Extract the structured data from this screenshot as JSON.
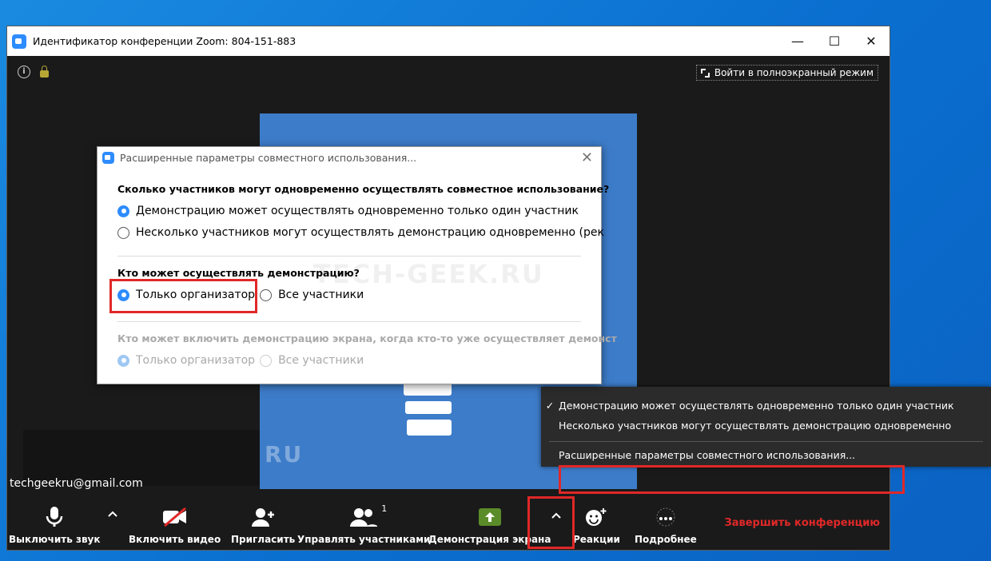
{
  "window": {
    "title": "Идентификатор конференции Zoom: 804-151-883",
    "controls": {
      "minimize": "—",
      "maximize": "☐",
      "close": "✕"
    }
  },
  "meeting": {
    "fullscreen_label": "Войти в полноэкранный режим",
    "participant_email": "techgeekru@gmail.com",
    "watermark": "TECH-GEEK.RU",
    "watermark_fragment": "RU"
  },
  "dialog": {
    "title": "Расширенные параметры совместного использования...",
    "close": "✕",
    "section1": {
      "question": "Сколько участников могут одновременно осуществлять совместное использование?",
      "options": [
        "Демонстрацию может осуществлять одновременно только один участник",
        "Несколько участников могут осуществлять демонстрацию одновременно (рек"
      ],
      "selected": 0
    },
    "section2": {
      "question": "Кто может осуществлять демонстрацию?",
      "options": [
        "Только организатор",
        "Все участники"
      ],
      "selected": 0
    },
    "section3": {
      "question": "Кто может включить демонстрацию экрана, когда кто-то уже осуществляет демонст",
      "options": [
        "Только организатор",
        "Все участники"
      ],
      "selected": 0
    }
  },
  "popup_menu": {
    "items": [
      {
        "label": "Демонстрацию может осуществлять одновременно только один участник",
        "checked": "✓"
      },
      {
        "label": "Несколько участников могут осуществлять демонстрацию одновременно",
        "checked": ""
      },
      {
        "label": "Расширенные параметры совместного использования...",
        "checked": ""
      }
    ]
  },
  "toolbar": {
    "mute": "Выключить звук",
    "video": "Включить видео",
    "invite": "Пригласить",
    "participants": "Управлять участниками",
    "participants_count": "1",
    "share": "Демонстрация экрана",
    "reactions": "Реакции",
    "more": "Подробнее",
    "end": "Завершить конференцию",
    "chevron": "^"
  },
  "colors": {
    "accent": "#2d8cff",
    "share_green": "#5b8c2a",
    "highlight_red": "#e02828",
    "end_red": "#e02828"
  }
}
